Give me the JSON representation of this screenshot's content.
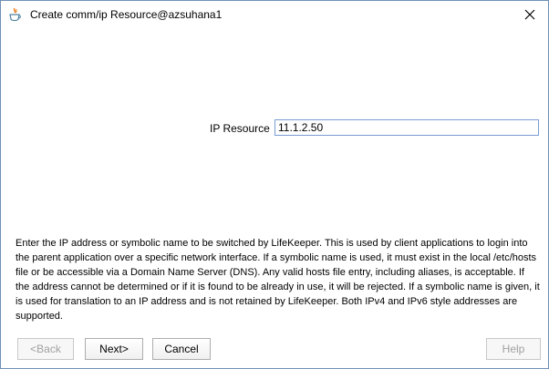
{
  "window": {
    "title": "Create comm/ip Resource@azsuhana1"
  },
  "form": {
    "ip_label": "IP Resource",
    "ip_value": "11.1.2.50"
  },
  "description": "Enter the IP address or symbolic name to be switched by LifeKeeper. This is used by client applications to login into the parent application over a specific network interface. If a symbolic name is used, it must exist in the local /etc/hosts file or be accessible via a Domain Name Server (DNS). Any valid hosts file entry, including aliases, is acceptable. If the address cannot be determined or if it is found to be already in use, it will be rejected. If a symbolic name is given, it is used for translation to an IP address and is not retained by LifeKeeper. Both IPv4 and IPv6 style addresses are supported.",
  "buttons": {
    "back": "<Back",
    "next": "Next>",
    "cancel": "Cancel",
    "help": "Help"
  },
  "icons": {
    "app": "java-icon",
    "close": "close-icon"
  }
}
